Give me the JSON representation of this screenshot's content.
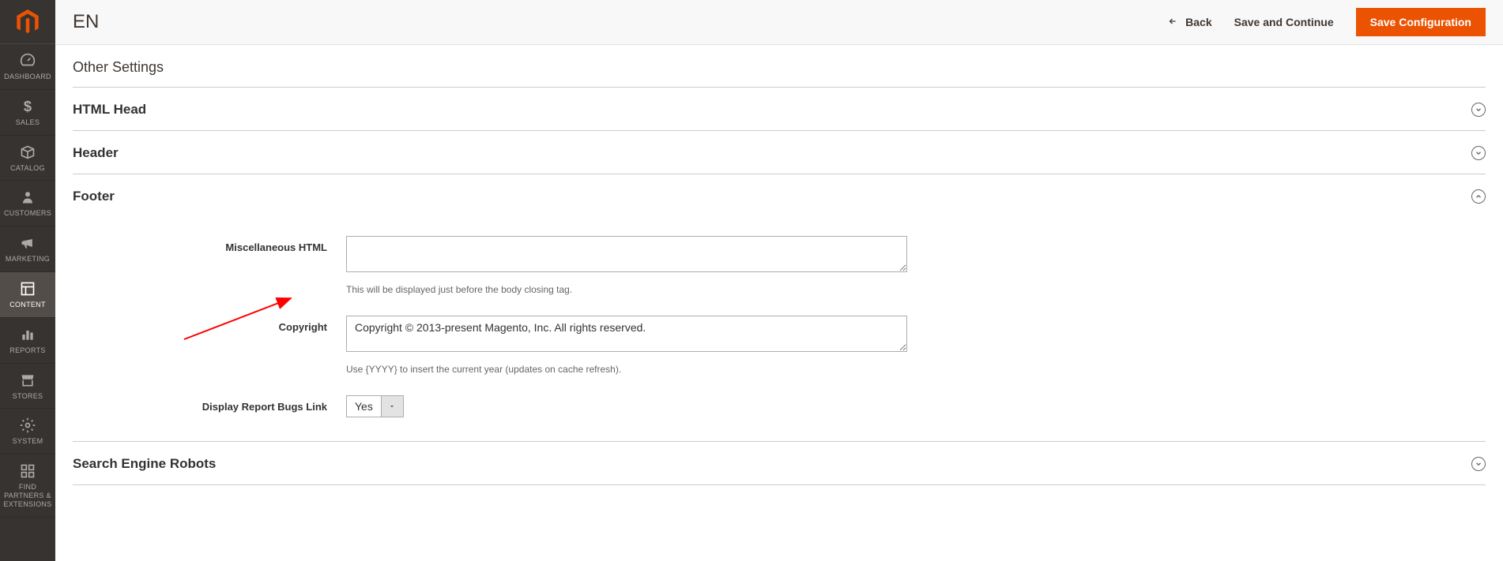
{
  "sidebar": {
    "items": [
      {
        "label": "DASHBOARD"
      },
      {
        "label": "SALES"
      },
      {
        "label": "CATALOG"
      },
      {
        "label": "CUSTOMERS"
      },
      {
        "label": "MARKETING"
      },
      {
        "label": "CONTENT"
      },
      {
        "label": "REPORTS"
      },
      {
        "label": "STORES"
      },
      {
        "label": "SYSTEM"
      },
      {
        "label": "FIND PARTNERS & EXTENSIONS"
      }
    ]
  },
  "header": {
    "title": "EN",
    "back": "Back",
    "save_continue": "Save and Continue",
    "save_config": "Save Configuration"
  },
  "sections": {
    "other_settings": "Other Settings",
    "html_head": "HTML Head",
    "header_sec": "Header",
    "footer_sec": "Footer",
    "search_robots": "Search Engine Robots"
  },
  "footer_form": {
    "misc_html_label": "Miscellaneous HTML",
    "misc_html_value": "",
    "misc_html_hint": "This will be displayed just before the body closing tag.",
    "copyright_label": "Copyright",
    "copyright_value": "Copyright © 2013-present Magento, Inc. All rights reserved.",
    "copyright_hint": "Use {YYYY} to insert the current year (updates on cache refresh).",
    "bugs_label": "Display Report Bugs Link",
    "bugs_value": "Yes"
  }
}
